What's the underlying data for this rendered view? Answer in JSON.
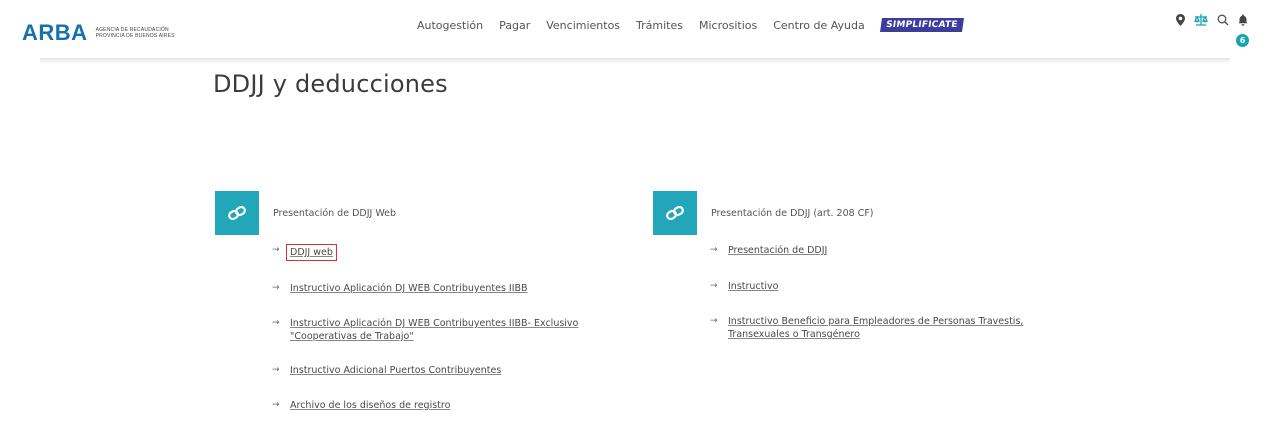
{
  "brand": {
    "name": "ARBA",
    "subtitle_line1": "Agencia de Recaudación",
    "subtitle_line2": "Provincia de Buenos Aires",
    "color": "#1a6fae"
  },
  "nav": {
    "items": [
      "Autogestión",
      "Pagar",
      "Vencimientos",
      "Trámites",
      "Micrositios",
      "Centro de Ayuda"
    ],
    "simplificate": "SIMPLIFICATE",
    "icons": [
      "location-pin-icon",
      "scale-icon",
      "search-icon",
      "bell-icon"
    ],
    "notifications": "6"
  },
  "page": {
    "title": "DDJJ y deducciones"
  },
  "sections": [
    {
      "title": "Presentación de DDJJ Web",
      "icon": "link-icon",
      "links": [
        [
          "DDJJ web"
        ],
        [
          "Instructivo Aplicación DJ WEB Contribuyentes IIBB"
        ],
        [
          "Instructivo Aplicación DJ WEB Contribuyentes IIBB- Exclusivo",
          "\"Cooperativas de Trabajo\""
        ],
        [
          "Instructivo Adicional Puertos Contribuyentes"
        ],
        [
          "Archivo de los diseños de registro"
        ]
      ]
    },
    {
      "title": "Presentación de DDJJ (art. 208 CF)",
      "icon": "link-icon",
      "links": [
        [
          "Presentación de DDJJ"
        ],
        [
          "Instructivo"
        ],
        [
          "Instructivo Beneficio para Empleadores de Personas Travestis,",
          "Transexuales o Transgénero"
        ]
      ]
    }
  ],
  "colors": {
    "accent": "#22a6b9",
    "simplificate_bg": "#3d3b9c",
    "highlight_box": "#d93030"
  }
}
